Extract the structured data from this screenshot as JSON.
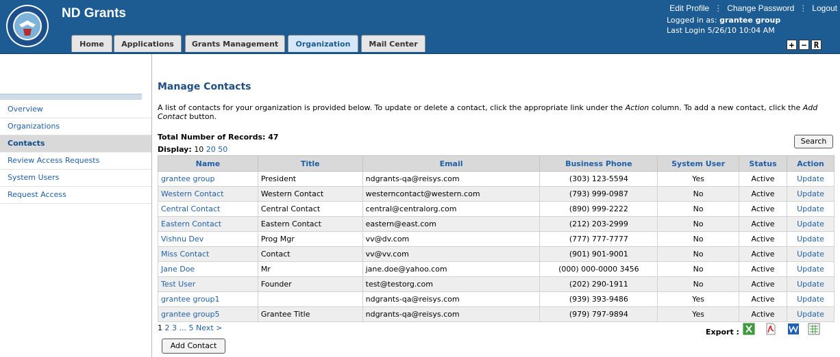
{
  "app": {
    "title": "ND Grants"
  },
  "header": {
    "tabs": [
      {
        "label": "Home"
      },
      {
        "label": "Applications"
      },
      {
        "label": "Grants Management"
      },
      {
        "label": "Organization",
        "active": true
      },
      {
        "label": "Mail Center"
      }
    ],
    "top_links": [
      "Edit Profile",
      "Change Password",
      "Logout"
    ],
    "logged_in_label": "Logged in as:",
    "logged_in_user": "grantee group",
    "last_login": "Last Login 5/26/10 10:04 AM",
    "zoom_buttons": [
      "+",
      "−",
      "R"
    ]
  },
  "sidebar": {
    "items": [
      {
        "label": "Overview"
      },
      {
        "label": "Organizations"
      },
      {
        "label": "Contacts",
        "active": true
      },
      {
        "label": "Review Access Requests"
      },
      {
        "label": "System Users"
      },
      {
        "label": "Request Access"
      }
    ]
  },
  "main": {
    "title": "Manage Contacts",
    "intro_1": "A list of contacts for your organization is provided below. To update or delete a contact, click the appropriate link under the ",
    "intro_action": "Action",
    "intro_2": " column. To add a new contact, click the ",
    "intro_add": "Add Contact",
    "intro_3": " button.",
    "total_records": "Total Number of Records: 47",
    "display_label": "Display:",
    "display_options": [
      "10",
      "20",
      "50"
    ],
    "search_label": "Search",
    "columns": [
      "Name",
      "Title",
      "Email",
      "Business Phone",
      "System User",
      "Status",
      "Action"
    ],
    "rows": [
      {
        "name": "grantee group",
        "title": "President",
        "email": "ndgrants-qa@reisys.com",
        "phone": "(303) 123-5594",
        "system_user": "Yes",
        "status": "Active",
        "action": "Update"
      },
      {
        "name": "Western Contact",
        "title": "Western Contact",
        "email": "westerncontact@western.com",
        "phone": "(793) 999-0987",
        "system_user": "No",
        "status": "Active",
        "action": "Update"
      },
      {
        "name": "Central Contact",
        "title": "Central Contact",
        "email": "central@centralorg.com",
        "phone": "(890) 999-2222",
        "system_user": "No",
        "status": "Active",
        "action": "Update"
      },
      {
        "name": "Eastern Contact",
        "title": "Eastern Contact",
        "email": "eastern@east.com",
        "phone": "(212) 203-2999",
        "system_user": "No",
        "status": "Active",
        "action": "Update"
      },
      {
        "name": "Vishnu Dev",
        "title": "Prog Mgr",
        "email": "vv@dv.com",
        "phone": "(777) 777-7777",
        "system_user": "No",
        "status": "Active",
        "action": "Update"
      },
      {
        "name": "Miss Contact",
        "title": "Contact",
        "email": "vv@vv.com",
        "phone": "(901) 901-9001",
        "system_user": "No",
        "status": "Active",
        "action": "Update"
      },
      {
        "name": "Jane Doe",
        "title": "Mr",
        "email": "jane.doe@yahoo.com",
        "phone": "(000) 000-0000 3456",
        "system_user": "No",
        "status": "Active",
        "action": "Update"
      },
      {
        "name": "Test User",
        "title": "Founder",
        "email": "test@testorg.com",
        "phone": "(202) 290-1911",
        "system_user": "No",
        "status": "Active",
        "action": "Update"
      },
      {
        "name": "grantee group1",
        "title": "",
        "email": "ndgrants-qa@reisys.com",
        "phone": "(939) 393-9486",
        "system_user": "Yes",
        "status": "Active",
        "action": "Update"
      },
      {
        "name": "grantee group5",
        "title": "Grantee Title",
        "email": "ndgrants-qa@reisys.com",
        "phone": "(979) 797-9894",
        "system_user": "Yes",
        "status": "Active",
        "action": "Update"
      }
    ],
    "pager": {
      "current": "1",
      "pages": [
        "2",
        "3",
        "...",
        "5"
      ],
      "next": "Next >"
    },
    "add_contact_label": "Add Contact",
    "export_label": "Export :",
    "export_icons": [
      "excel-icon",
      "pdf-icon",
      "word-icon",
      "csv-icon"
    ]
  }
}
